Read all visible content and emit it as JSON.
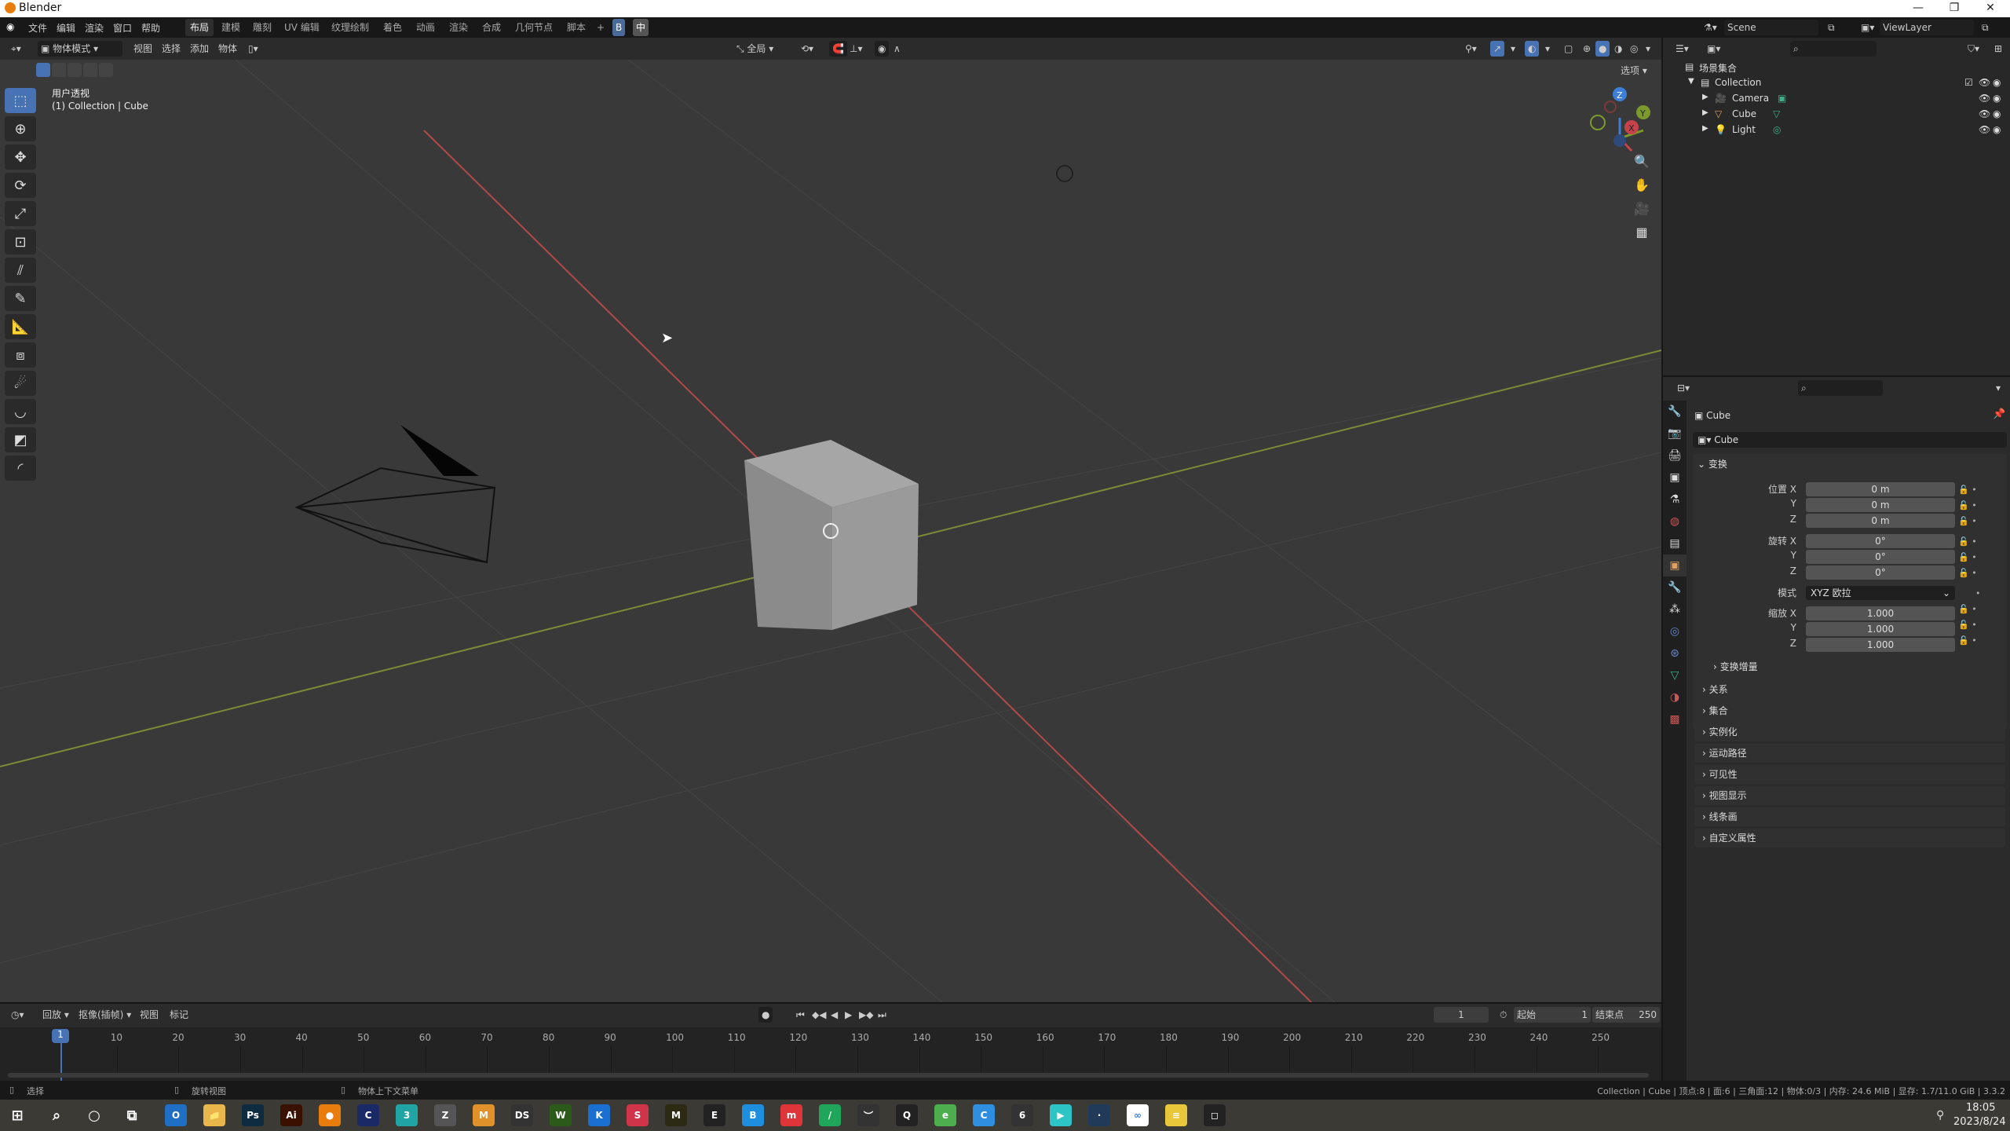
{
  "window": {
    "title": "Blender",
    "minimize": "—",
    "maximize": "❐",
    "close": "✕"
  },
  "menubar": {
    "menus": [
      "文件",
      "编辑",
      "渲染",
      "窗口",
      "帮助"
    ],
    "workspaces": [
      "布局",
      "建模",
      "雕刻",
      "UV 编辑",
      "纹理绘制",
      "着色",
      "动画",
      "渲染",
      "合成",
      "几何节点",
      "脚本"
    ],
    "active_workspace": "布局",
    "add_workspace": "+",
    "ime_label": "中"
  },
  "viewport_header": {
    "mode": "物体模式",
    "menus": [
      "视图",
      "选择",
      "添加",
      "物体"
    ],
    "transform_orientation": "全局",
    "options_label": "选项"
  },
  "viewport": {
    "view_name": "用户透视",
    "context": "(1) Collection | Cube",
    "gizmo_axes": [
      "X",
      "Y",
      "Z"
    ],
    "colors": {
      "x_axis": "#c6424a",
      "y_axis": "#7c9a2c",
      "z_axis": "#3d7fd8",
      "active_tool": "#4772b3"
    }
  },
  "tools": [
    "select-box",
    "cursor",
    "move",
    "rotate",
    "scale",
    "transform",
    "annotate",
    "annotate-draw",
    "measure",
    "add-cube",
    "shear",
    "curve-tool",
    "knife",
    "bevel"
  ],
  "outliner": {
    "scene": "Scene",
    "view_layer": "ViewLayer",
    "search_placeholder": "",
    "root": "场景集合",
    "collection": "Collection",
    "items": [
      {
        "name": "Camera",
        "type": "camera"
      },
      {
        "name": "Cube",
        "type": "mesh"
      },
      {
        "name": "Light",
        "type": "light"
      }
    ]
  },
  "properties": {
    "object_name": "Cube",
    "data_name": "Cube",
    "transform_section": "变换",
    "location_label": "位置 X",
    "rotation_label": "旋转 X",
    "scale_label": "缩放 X",
    "axis_y": "Y",
    "axis_z": "Z",
    "location": [
      "0 m",
      "0 m",
      "0 m"
    ],
    "rotation": [
      "0°",
      "0°",
      "0°"
    ],
    "mode_label": "模式",
    "rotation_mode": "XYZ 欧拉",
    "scale": [
      "1.000",
      "1.000",
      "1.000"
    ],
    "delta_transform": "变换增量",
    "sections": [
      "关系",
      "集合",
      "实例化",
      "运动路径",
      "可见性",
      "视图显示",
      "线条画",
      "自定义属性"
    ]
  },
  "timeline": {
    "menus": [
      "回放",
      "抠像(插帧)",
      "视图",
      "标记"
    ],
    "current_frame": "1",
    "start_label": "起始",
    "start": "1",
    "end_label": "结束点",
    "end": "250",
    "ticks": [
      "10",
      "20",
      "30",
      "40",
      "50",
      "60",
      "70",
      "80",
      "90",
      "100",
      "110",
      "120",
      "130",
      "140",
      "150",
      "160",
      "170",
      "180",
      "190",
      "200",
      "210",
      "220",
      "230",
      "240",
      "250"
    ]
  },
  "statusbar": {
    "hints": [
      "选择",
      "旋转视图",
      "物体上下文菜单"
    ],
    "stats": "Collection | Cube | 顶点:8 | 面:6 | 三角面:12 | 物体:0/3 | 内存: 24.6 MiB | 显存: 1.7/11.0 GiB | 3.3.2"
  },
  "taskbar": {
    "time": "18:05",
    "date": "2023/8/24",
    "apps": [
      {
        "name": "outlook",
        "label": "O",
        "color": "#1f6fc5"
      },
      {
        "name": "explorer",
        "label": "📁",
        "color": "#e8b64a"
      },
      {
        "name": "photoshop",
        "label": "Ps",
        "color": "#0e2b3f"
      },
      {
        "name": "illustrator",
        "label": "Ai",
        "color": "#3a1100"
      },
      {
        "name": "blender",
        "label": "●",
        "color": "#e87d0d"
      },
      {
        "name": "cinema4d",
        "label": "C",
        "color": "#1b2a66"
      },
      {
        "name": "3dsmax",
        "label": "3",
        "color": "#20a4a4"
      },
      {
        "name": "zbrush",
        "label": "Z",
        "color": "#555"
      },
      {
        "name": "marmoset",
        "label": "M",
        "color": "#e0912a"
      },
      {
        "name": "daz",
        "label": "DS",
        "color": "#333"
      },
      {
        "name": "wechat-work",
        "label": "W",
        "color": "#2b5a1a"
      },
      {
        "name": "keyshot",
        "label": "K",
        "color": "#1b6fd0"
      },
      {
        "name": "substance",
        "label": "S",
        "color": "#d0344b"
      },
      {
        "name": "marvelous",
        "label": "M",
        "color": "#2c2a12"
      },
      {
        "name": "epic-games",
        "label": "E",
        "color": "#222"
      },
      {
        "name": "bilibili",
        "label": "B",
        "color": "#1d8fde"
      },
      {
        "name": "meitu",
        "label": "m",
        "color": "#e0343b"
      },
      {
        "name": "speedtree",
        "label": "/",
        "color": "#1fa65a"
      },
      {
        "name": "app-yellow",
        "label": "︶",
        "color": "#333"
      },
      {
        "name": "qq",
        "label": "Q",
        "color": "#222"
      },
      {
        "name": "browser-360",
        "label": "e",
        "color": "#4cae4c"
      },
      {
        "name": "chrome",
        "label": "C",
        "color": "#2f8ee0"
      },
      {
        "name": "app-6",
        "label": "6",
        "color": "#333"
      },
      {
        "name": "video",
        "label": "▶",
        "color": "#2cc4c4"
      },
      {
        "name": "app-dark",
        "label": "·",
        "color": "#223a5a"
      },
      {
        "name": "baidu-netdisk",
        "label": "∞",
        "color": "#fff"
      },
      {
        "name": "notes",
        "label": "≡",
        "color": "#e8c83a"
      },
      {
        "name": "camera",
        "label": "◻",
        "color": "#222"
      }
    ]
  }
}
